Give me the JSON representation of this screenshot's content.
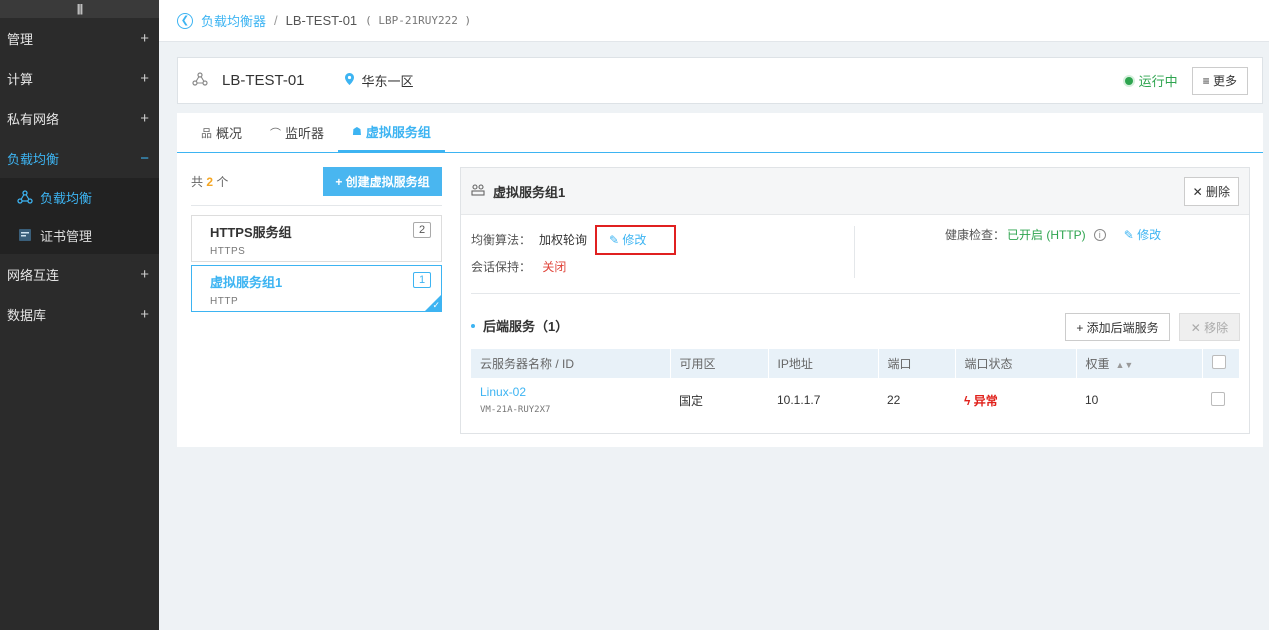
{
  "sidebar": {
    "top_icon": "menu-icon",
    "items": [
      {
        "label": "管理"
      },
      {
        "label": "计算"
      },
      {
        "label": "私有网络"
      },
      {
        "label": "负载均衡"
      },
      {
        "label": "网络互连"
      },
      {
        "label": "数据库"
      }
    ],
    "sub_items": [
      {
        "label": "负载均衡"
      },
      {
        "label": "证书管理"
      }
    ]
  },
  "breadcrumb": {
    "parent": "负载均衡器",
    "separator": "/",
    "current": "LB-TEST-01",
    "id": "( LBP-21RUY222 )"
  },
  "header": {
    "name": "LB-TEST-01",
    "location": "华东一区",
    "status": "运行中",
    "more_label": "≡ 更多"
  },
  "tabs": [
    {
      "label": "概况"
    },
    {
      "label": "监听器"
    },
    {
      "label": "虚拟服务组"
    }
  ],
  "left": {
    "count_prefix": "共",
    "count": "2",
    "count_suffix": "个",
    "create_label": "+ 创建虚拟服务组",
    "groups": [
      {
        "name": "HTTPS服务组",
        "proto": "HTTPS",
        "badge": "2"
      },
      {
        "name": "虚拟服务组1",
        "proto": "HTTP",
        "badge": "1"
      }
    ]
  },
  "detail": {
    "title": "虚拟服务组1",
    "delete_label": "✕ 删除",
    "algo_label": "均衡算法：",
    "algo_value": "加权轮询",
    "edit_label": "修改",
    "session_label": "会话保持：",
    "session_value": "关闭",
    "health_label": "健康检查：",
    "health_value": "已开启 (HTTP)",
    "backend_title": "后端服务（1）",
    "add_label": "+ 添加后端服务",
    "remove_label": "✕ 移除",
    "columns": [
      "云服务器名称 / ID",
      "可用区",
      "IP地址",
      "端口",
      "端口状态",
      "权重"
    ],
    "rows": [
      {
        "name": "Linux-02",
        "id": "VM-21A-RUY2X7",
        "zone": "国定",
        "ip": "10.1.1.7",
        "port": "22",
        "status": "异常",
        "weight": "10"
      }
    ]
  },
  "colors": {
    "accent": "#3db4f2",
    "ok": "#2ea44f",
    "error": "#e0201a",
    "sidebar": "#2b2b2b"
  }
}
